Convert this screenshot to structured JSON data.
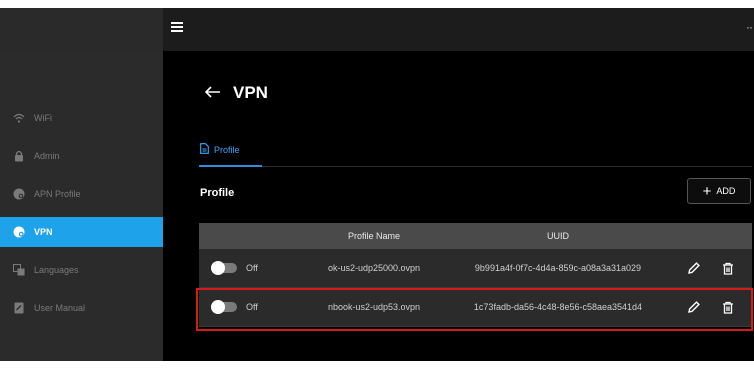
{
  "page": {
    "title": "VPN",
    "more_glyph": "··"
  },
  "sidebar": {
    "items": [
      {
        "label": "WiFi",
        "icon": "wifi-icon",
        "active": false
      },
      {
        "label": "Admin",
        "icon": "lock-icon",
        "active": false
      },
      {
        "label": "APN Profile",
        "icon": "apn-profile-icon",
        "active": false
      },
      {
        "label": "VPN",
        "icon": "vpn-icon",
        "active": true
      },
      {
        "label": "Languages",
        "icon": "language-icon",
        "active": false
      },
      {
        "label": "User Manual",
        "icon": "manual-icon",
        "active": false
      }
    ]
  },
  "tabs": [
    {
      "label": "Profile",
      "active": true
    }
  ],
  "section": {
    "title": "Profile",
    "add_label": "ADD"
  },
  "table": {
    "headers": [
      "",
      "Profile Name",
      "UUID",
      ""
    ],
    "rows": [
      {
        "toggle_state": "Off",
        "name": "ok-us2-udp25000.ovpn",
        "uuid": "9b991a4f-0f7c-4d4a-859c-a08a3a31a029"
      },
      {
        "toggle_state": "Off",
        "name": "nbook-us2-udp53.ovpn",
        "uuid": "1c73fadb-da56-4c48-8e56-c58aea3541d4"
      }
    ]
  },
  "colors": {
    "accent": "#1ea2ea",
    "tab_active": "#3aa9ff",
    "highlight": "#d51a1a"
  }
}
